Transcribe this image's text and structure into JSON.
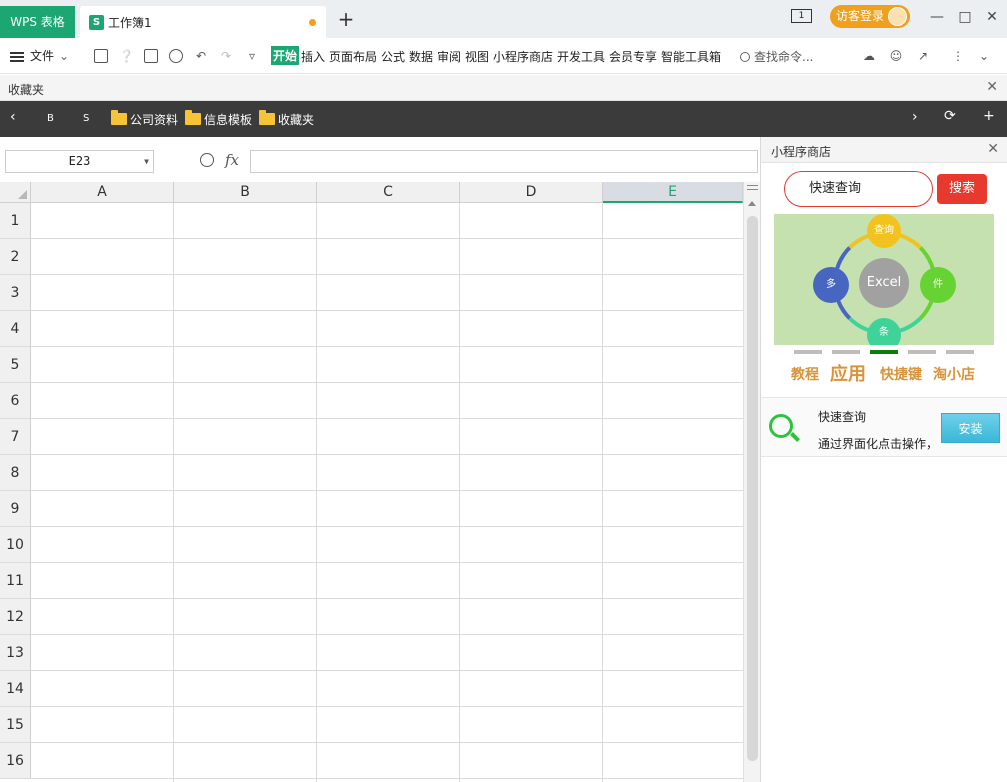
{
  "titlebar": {
    "app_tab": "WPS 表格",
    "doc_tab": "工作簿1",
    "doc_icon": "S",
    "new_tab": "+",
    "login": "访客登录",
    "window_box_num": "1"
  },
  "toolbar": {
    "menu": "文件",
    "ribbon": [
      "开始",
      "插入",
      "页面布局",
      "公式",
      "数据",
      "审阅",
      "视图",
      "小程序商店",
      "开发工具",
      "会员专享",
      "智能工具箱"
    ],
    "search_placeholder": "查找命令..."
  },
  "favorites": {
    "title": "收藏夹"
  },
  "bookmarks": {
    "items": [
      "B",
      "S",
      "公司资料",
      "信息模板",
      "收藏夹"
    ]
  },
  "formula": {
    "name_box": "E23",
    "fx": "fx",
    "value": ""
  },
  "sheet": {
    "columns": [
      "A",
      "B",
      "C",
      "D",
      "E"
    ],
    "rows": [
      "1",
      "2",
      "3",
      "4",
      "5",
      "6",
      "7",
      "8",
      "9",
      "10",
      "11",
      "12",
      "13",
      "14",
      "15",
      "16"
    ],
    "active_column": "E"
  },
  "panel": {
    "title": "小程序商店",
    "search_value": "快速查询",
    "search_button": "搜索",
    "banner": {
      "center": "Excel",
      "nodes": [
        "查询",
        "件",
        "条",
        "多"
      ]
    },
    "categories": [
      "教程",
      "应用",
      "快捷键",
      "淘小店"
    ],
    "app": {
      "name": "快速查询",
      "desc": "通过界面化点击操作，",
      "install": "安装"
    }
  },
  "colors": {
    "accent": "#1ba672",
    "login_orange": "#f1a01d",
    "search_red": "#e8392f",
    "dark_bar": "#3b3b3b"
  }
}
